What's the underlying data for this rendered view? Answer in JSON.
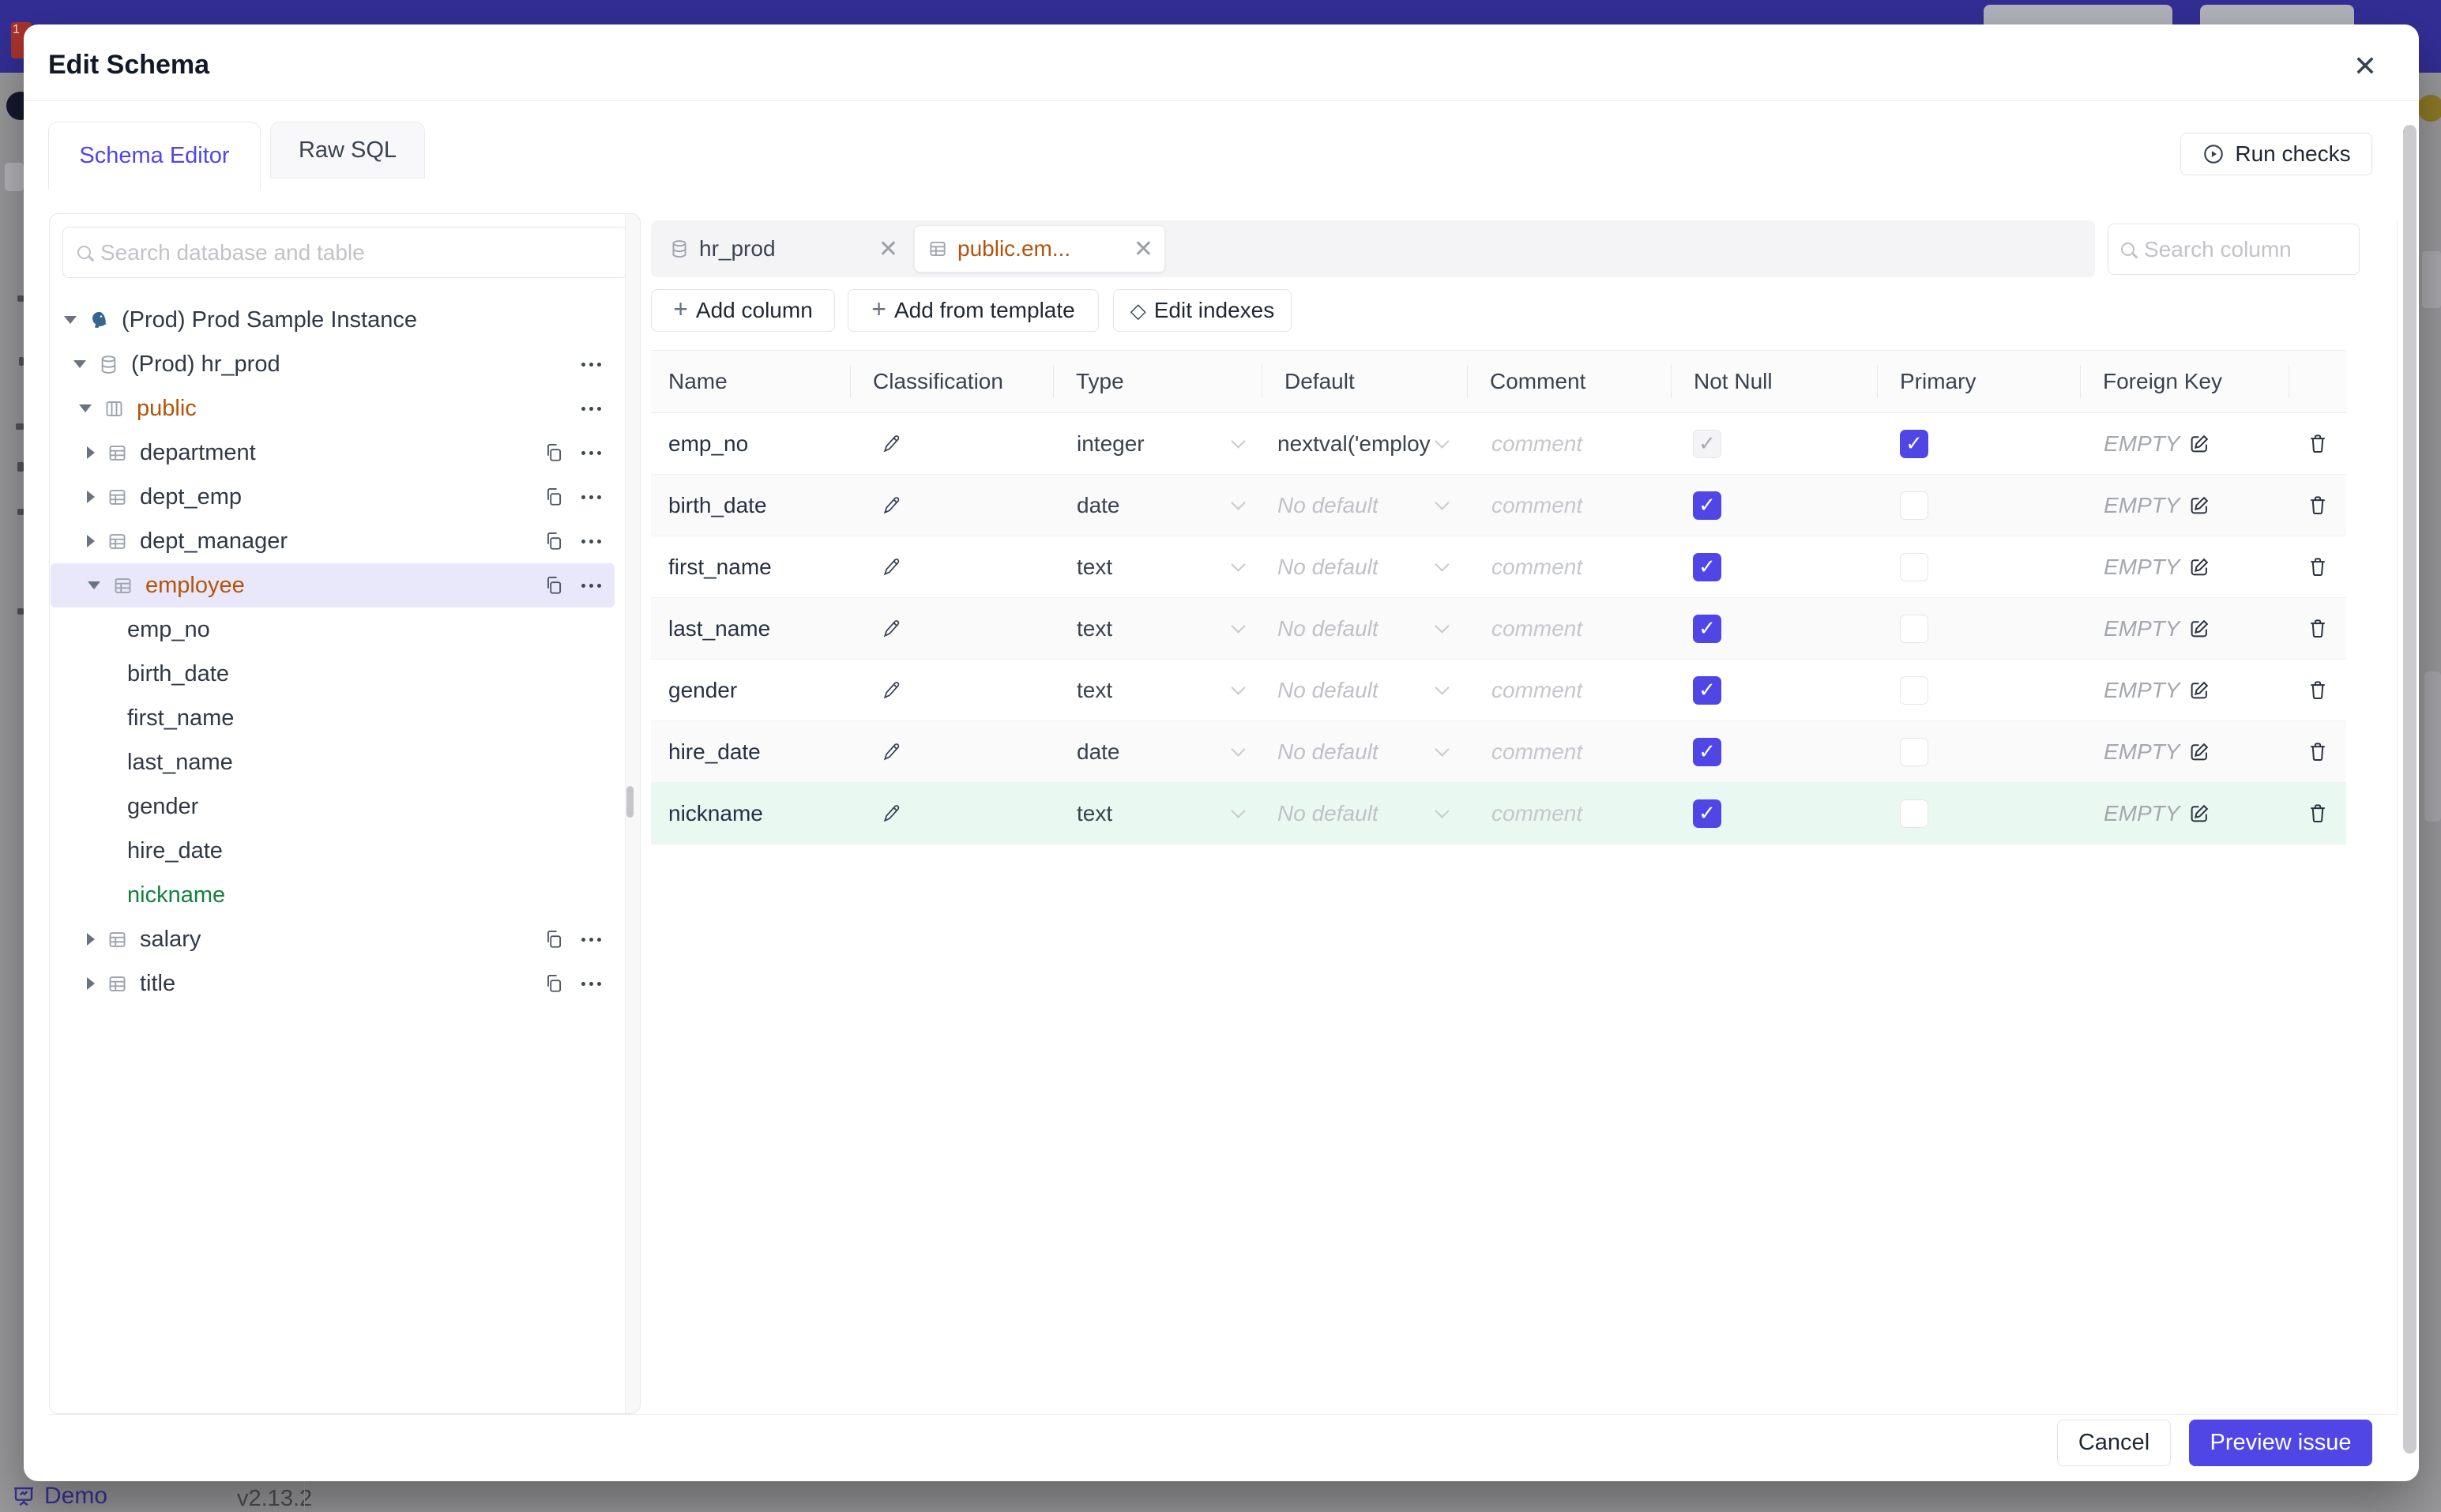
{
  "colors": {
    "accent": "#4f46e5",
    "table_name_orange": "#b45309",
    "new_column_green": "#15803d",
    "header_bar": "#332e95"
  },
  "page_behind": {
    "footer": {
      "demo_label": "Demo",
      "version": "v2.13.2"
    }
  },
  "modal": {
    "title": "Edit Schema",
    "tabs": [
      {
        "label": "Schema Editor",
        "active": true
      },
      {
        "label": "Raw SQL",
        "active": false
      }
    ],
    "run_checks_label": "Run checks",
    "sidebar": {
      "search_placeholder": "Search database and table",
      "selected_table": "employee",
      "highlighted_new_column": "nickname",
      "tree": [
        {
          "env": "(Prod)",
          "label": "Prod Sample Instance",
          "type": "instance"
        },
        {
          "env": "(Prod)",
          "label": "hr_prod",
          "type": "database"
        },
        {
          "label": "public",
          "type": "schema"
        },
        {
          "label": "department",
          "type": "table"
        },
        {
          "label": "dept_emp",
          "type": "table"
        },
        {
          "label": "dept_manager",
          "type": "table"
        },
        {
          "label": "employee",
          "type": "table"
        },
        {
          "label": "emp_no",
          "type": "column"
        },
        {
          "label": "birth_date",
          "type": "column"
        },
        {
          "label": "first_name",
          "type": "column"
        },
        {
          "label": "last_name",
          "type": "column"
        },
        {
          "label": "gender",
          "type": "column"
        },
        {
          "label": "hire_date",
          "type": "column"
        },
        {
          "label": "nickname",
          "type": "column"
        },
        {
          "label": "salary",
          "type": "table"
        },
        {
          "label": "title",
          "type": "table"
        }
      ]
    },
    "editor": {
      "tabs": [
        {
          "label": "hr_prod",
          "type": "database",
          "active": false
        },
        {
          "label": "public.em...",
          "type": "table",
          "active": true
        }
      ],
      "toolbar": {
        "add_column": "Add column",
        "add_from_template": "Add from template",
        "edit_indexes": "Edit indexes"
      },
      "search_placeholder": "Search column",
      "table": {
        "headers": [
          "Name",
          "Classification",
          "Type",
          "Default",
          "Comment",
          "Not Null",
          "Primary",
          "Foreign Key"
        ],
        "comment_placeholder": "comment",
        "foreign_key_empty": "EMPTY",
        "rows": [
          {
            "name": "emp_no",
            "type": "integer",
            "default": "nextval('employ",
            "not_null": "disabled",
            "primary": true
          },
          {
            "name": "birth_date",
            "type": "date",
            "default": "No default",
            "not_null": true,
            "primary": false
          },
          {
            "name": "first_name",
            "type": "text",
            "default": "No default",
            "not_null": true,
            "primary": false
          },
          {
            "name": "last_name",
            "type": "text",
            "default": "No default",
            "not_null": true,
            "primary": false
          },
          {
            "name": "gender",
            "type": "text",
            "default": "No default",
            "not_null": true,
            "primary": false
          },
          {
            "name": "hire_date",
            "type": "date",
            "default": "No default",
            "not_null": true,
            "primary": false
          },
          {
            "name": "nickname",
            "type": "text",
            "default": "No default",
            "not_null": true,
            "primary": false
          }
        ]
      },
      "footer": {
        "cancel": "Cancel",
        "preview_issue": "Preview issue"
      }
    }
  }
}
